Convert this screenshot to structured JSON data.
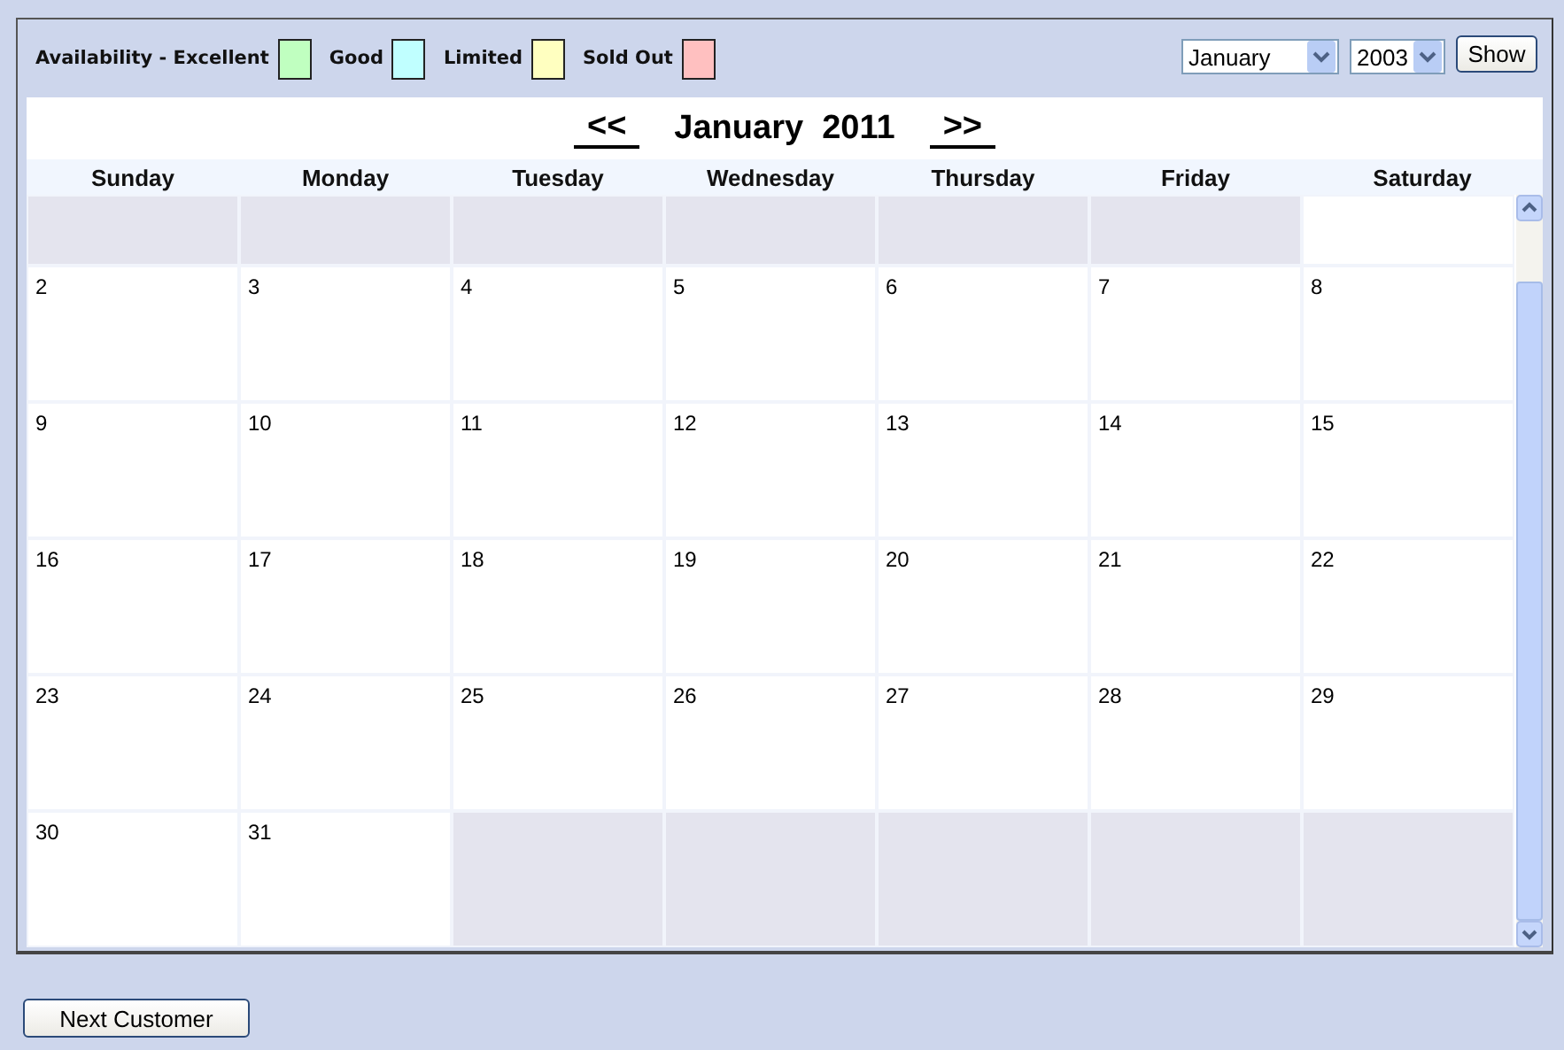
{
  "legend": {
    "items": [
      {
        "label": "Availability - Excellent",
        "color": "#c0ffc0"
      },
      {
        "label": "Good",
        "color": "#c0ffff"
      },
      {
        "label": "Limited",
        "color": "#ffffc0"
      },
      {
        "label": "Sold Out",
        "color": "#ffc0c0"
      }
    ]
  },
  "month_select": {
    "value": "January"
  },
  "year_select": {
    "value": "2003"
  },
  "show_button": "Show",
  "nav": {
    "prev": "<<",
    "title": "January  2011",
    "next": ">>"
  },
  "weekdays": [
    "Sunday",
    "Monday",
    "Tuesday",
    "Wednesday",
    "Thursday",
    "Friday",
    "Saturday"
  ],
  "weeks": [
    [
      {
        "kind": "empty"
      },
      {
        "kind": "empty"
      },
      {
        "kind": "empty"
      },
      {
        "kind": "empty"
      },
      {
        "kind": "empty"
      },
      {
        "kind": "empty"
      },
      {
        "kind": "day"
      }
    ],
    [
      {
        "kind": "day",
        "day": "2"
      },
      {
        "kind": "day",
        "day": "3"
      },
      {
        "kind": "day",
        "day": "4"
      },
      {
        "kind": "day",
        "day": "5"
      },
      {
        "kind": "day",
        "day": "6"
      },
      {
        "kind": "day",
        "day": "7"
      },
      {
        "kind": "day",
        "day": "8"
      }
    ],
    [
      {
        "kind": "day",
        "day": "9"
      },
      {
        "kind": "day",
        "day": "10"
      },
      {
        "kind": "day",
        "day": "11"
      },
      {
        "kind": "day",
        "day": "12"
      },
      {
        "kind": "day",
        "day": "13"
      },
      {
        "kind": "day",
        "day": "14"
      },
      {
        "kind": "day",
        "day": "15"
      }
    ],
    [
      {
        "kind": "day",
        "day": "16"
      },
      {
        "kind": "day",
        "day": "17"
      },
      {
        "kind": "day",
        "day": "18"
      },
      {
        "kind": "day",
        "day": "19"
      },
      {
        "kind": "day",
        "day": "20"
      },
      {
        "kind": "day",
        "day": "21"
      },
      {
        "kind": "day",
        "day": "22"
      }
    ],
    [
      {
        "kind": "day",
        "day": "23"
      },
      {
        "kind": "day",
        "day": "24"
      },
      {
        "kind": "day",
        "day": "25"
      },
      {
        "kind": "day",
        "day": "26"
      },
      {
        "kind": "day",
        "day": "27"
      },
      {
        "kind": "day",
        "day": "28"
      },
      {
        "kind": "day",
        "day": "29"
      }
    ],
    [
      {
        "kind": "day",
        "day": "30"
      },
      {
        "kind": "day",
        "day": "31"
      },
      {
        "kind": "empty"
      },
      {
        "kind": "empty"
      },
      {
        "kind": "empty"
      },
      {
        "kind": "empty"
      },
      {
        "kind": "empty"
      }
    ]
  ],
  "next_button": "Next Customer"
}
